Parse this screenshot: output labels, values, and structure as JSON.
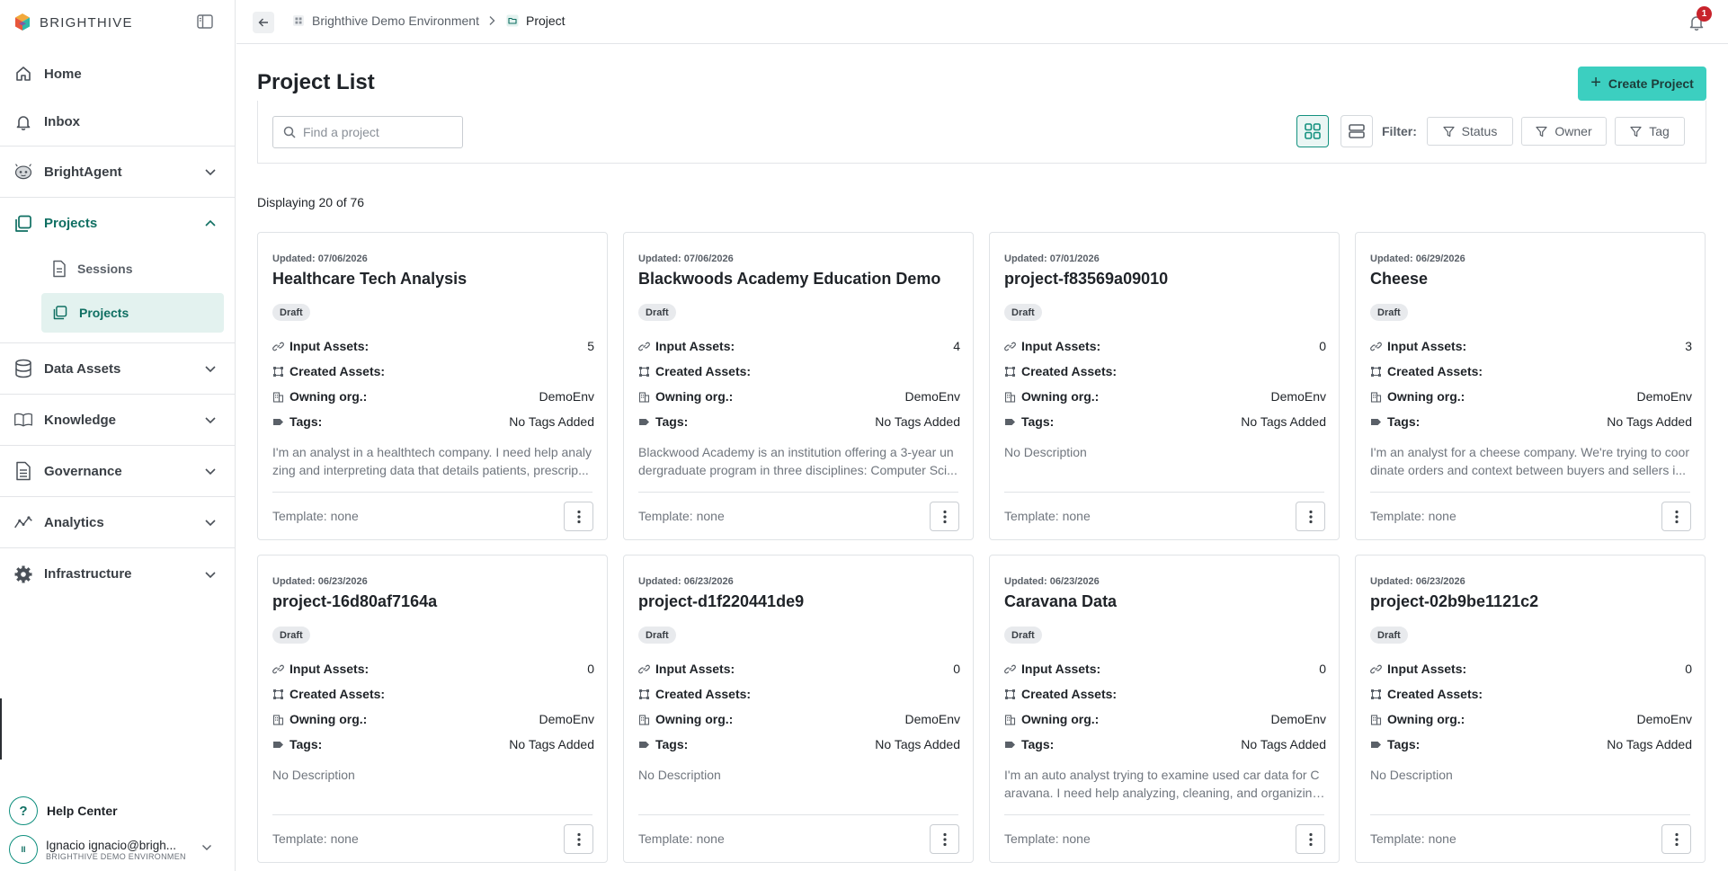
{
  "brand": {
    "name": "BRIGHTHIVE"
  },
  "sidebar": {
    "items": [
      {
        "label": "Home",
        "icon": "home-icon"
      },
      {
        "label": "Inbox",
        "icon": "bell-icon"
      },
      {
        "label": "BrightAgent",
        "icon": "robot-icon"
      },
      {
        "label": "Projects",
        "icon": "projects-icon"
      },
      {
        "label": "Data Assets",
        "icon": "database-icon"
      },
      {
        "label": "Knowledge",
        "icon": "book-icon"
      },
      {
        "label": "Governance",
        "icon": "document-icon"
      },
      {
        "label": "Analytics",
        "icon": "analytics-icon"
      },
      {
        "label": "Infrastructure",
        "icon": "gear-icon"
      }
    ],
    "sub_items": [
      {
        "label": "Sessions"
      },
      {
        "label": "Projects"
      }
    ],
    "help": {
      "label": "Help Center",
      "symbol": "?"
    },
    "user": {
      "initials": "II",
      "name": "Ignacio ignacio@brigh...",
      "env": "BRIGHTHIVE DEMO ENVIRONMENT"
    }
  },
  "topbar": {
    "crumbs": [
      "Brighthive Demo Environment",
      "Project"
    ],
    "notifications": "1"
  },
  "main": {
    "title": "Project List",
    "create_label": "Create Project",
    "search_placeholder": "Find a project",
    "filter_label": "Filter:",
    "filters": [
      "Status",
      "Owner",
      "Tag"
    ],
    "display_count": "Displaying 20 of 76"
  },
  "labels": {
    "input_assets": "Input Assets:",
    "created_assets": "Created Assets:",
    "owning_org": "Owning org.:",
    "tags": "Tags:"
  },
  "colors": {
    "accent": "#3ccfc0",
    "accent_dark": "#0f6f62",
    "badge_bg": "#e8eaed",
    "notification": "#c8232c"
  },
  "cards": [
    {
      "updated": "Updated: 07/06/2026",
      "title": "Healthcare Tech Analysis",
      "status": "Draft",
      "input_assets": "5",
      "created_assets": "",
      "owning_org": "DemoEnv",
      "tags": "No Tags Added",
      "description": "I'm an analyst in a healthtech company. I need help analyzing and interpreting data that details patients, prescrip...",
      "template": "Template: none"
    },
    {
      "updated": "Updated: 07/06/2026",
      "title": "Blackwoods Academy Education Demo",
      "status": "Draft",
      "input_assets": "4",
      "created_assets": "",
      "owning_org": "DemoEnv",
      "tags": "No Tags Added",
      "description": "Blackwood Academy is an institution offering a 3-year undergraduate program in three disciplines: Computer Sci...",
      "template": "Template: none"
    },
    {
      "updated": "Updated: 07/01/2026",
      "title": "project-f83569a09010",
      "status": "Draft",
      "input_assets": "0",
      "created_assets": "",
      "owning_org": "DemoEnv",
      "tags": "No Tags Added",
      "description": "No Description",
      "template": "Template: none"
    },
    {
      "updated": "Updated: 06/29/2026",
      "title": "Cheese",
      "status": "Draft",
      "input_assets": "3",
      "created_assets": "",
      "owning_org": "DemoEnv",
      "tags": "No Tags Added",
      "description": "I'm an analyst for a cheese company. We're trying to coordinate orders and context between buyers and sellers i...",
      "template": "Template: none"
    },
    {
      "updated": "Updated: 06/23/2026",
      "title": "project-16d80af7164a",
      "status": "Draft",
      "input_assets": "0",
      "created_assets": "",
      "owning_org": "DemoEnv",
      "tags": "No Tags Added",
      "description": "No Description",
      "template": "Template: none"
    },
    {
      "updated": "Updated: 06/23/2026",
      "title": "project-d1f220441de9",
      "status": "Draft",
      "input_assets": "0",
      "created_assets": "",
      "owning_org": "DemoEnv",
      "tags": "No Tags Added",
      "description": "No Description",
      "template": "Template: none"
    },
    {
      "updated": "Updated: 06/23/2026",
      "title": "Caravana Data",
      "status": "Draft",
      "input_assets": "0",
      "created_assets": "",
      "owning_org": "DemoEnv",
      "tags": "No Tags Added",
      "description": "I'm an auto analyst trying to examine used car data for Caravana. I need help analyzing, cleaning, and organizing...",
      "template": "Template: none"
    },
    {
      "updated": "Updated: 06/23/2026",
      "title": "project-02b9be1121c2",
      "status": "Draft",
      "input_assets": "0",
      "created_assets": "",
      "owning_org": "DemoEnv",
      "tags": "No Tags Added",
      "description": "No Description",
      "template": "Template: none"
    }
  ]
}
